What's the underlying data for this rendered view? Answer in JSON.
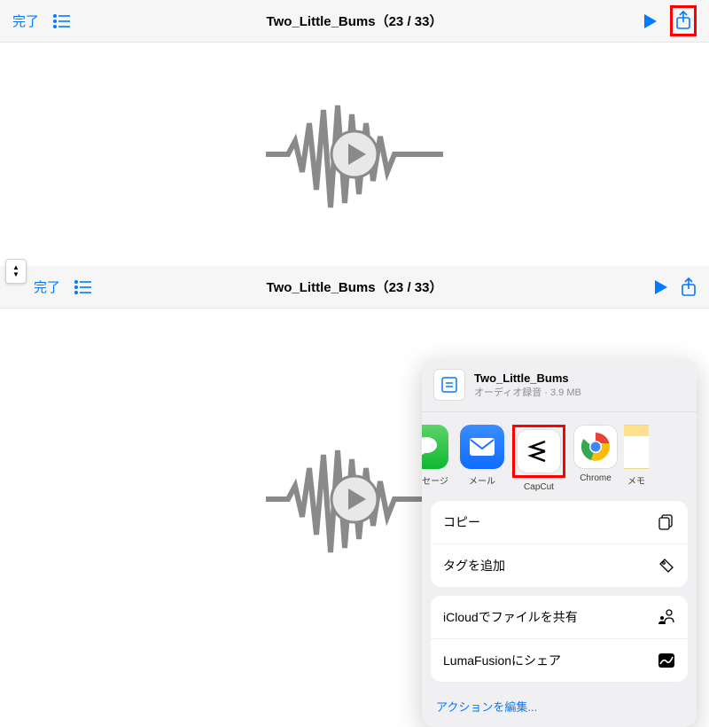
{
  "top": {
    "toolbar": {
      "done": "完了",
      "title": "Two_Little_Bums（23 / 33）"
    }
  },
  "bottom": {
    "toolbar": {
      "done": "完了",
      "title": "Two_Little_Bums（23 / 33）"
    },
    "sheet": {
      "file_name": "Two_Little_Bums",
      "file_meta": "オーディオ録音 · 3.9 MB",
      "apps": {
        "messages": "メッセージ",
        "mail": "メール",
        "capcut": "CapCut",
        "chrome": "Chrome",
        "notes": "メモ"
      },
      "actions": {
        "copy": "コピー",
        "add_tag": "タグを追加",
        "icloud_share": "iCloudでファイルを共有",
        "lumafusion": "LumaFusionにシェア"
      },
      "edit_actions": "アクションを編集..."
    }
  }
}
